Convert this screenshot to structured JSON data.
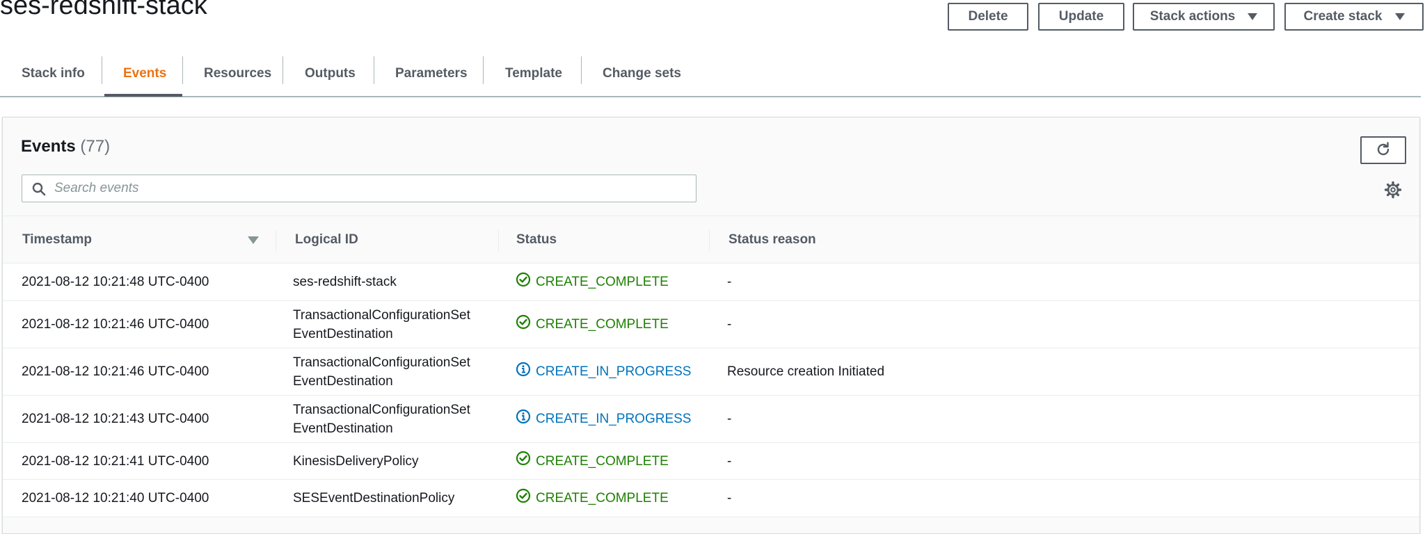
{
  "header": {
    "title": "ses-redshift-stack",
    "buttons": {
      "delete": "Delete",
      "update": "Update",
      "stack_actions": "Stack actions",
      "create_stack": "Create stack"
    }
  },
  "tabs": [
    {
      "label": "Stack info"
    },
    {
      "label": "Events"
    },
    {
      "label": "Resources"
    },
    {
      "label": "Outputs"
    },
    {
      "label": "Parameters"
    },
    {
      "label": "Template"
    },
    {
      "label": "Change sets"
    }
  ],
  "active_tab": "Events",
  "events": {
    "title": "Events",
    "count": "(77)",
    "search_placeholder": "Search events",
    "columns": [
      "Timestamp",
      "Logical ID",
      "Status",
      "Status reason"
    ],
    "rows": [
      {
        "timestamp": "2021-08-12 10:21:48 UTC-0400",
        "logical_id": "ses-redshift-stack",
        "status": "CREATE_COMPLETE",
        "reason": "-"
      },
      {
        "timestamp": "2021-08-12 10:21:46 UTC-0400",
        "logical_id": "TransactionalConfigurationSet\nEventDestination",
        "status": "CREATE_COMPLETE",
        "reason": "-"
      },
      {
        "timestamp": "2021-08-12 10:21:46 UTC-0400",
        "logical_id": "TransactionalConfigurationSet\nEventDestination",
        "status": "CREATE_IN_PROGRESS",
        "reason": "Resource creation Initiated"
      },
      {
        "timestamp": "2021-08-12 10:21:43 UTC-0400",
        "logical_id": "TransactionalConfigurationSet\nEventDestination",
        "status": "CREATE_IN_PROGRESS",
        "reason": "-"
      },
      {
        "timestamp": "2021-08-12 10:21:41 UTC-0400",
        "logical_id": "KinesisDeliveryPolicy",
        "status": "CREATE_COMPLETE",
        "reason": "-"
      },
      {
        "timestamp": "2021-08-12 10:21:40 UTC-0400",
        "logical_id": "SESEventDestinationPolicy",
        "status": "CREATE_COMPLETE",
        "reason": "-"
      }
    ]
  },
  "colors": {
    "accent": "#ec7211",
    "success": "#1d8102",
    "info": "#0073bb",
    "text": "#16191f",
    "muted": "#545b64"
  },
  "icons": {
    "search": "search-icon",
    "refresh": "refresh-icon",
    "settings": "gear-icon",
    "success": "check-circle-icon",
    "in_progress": "info-circle-icon",
    "sort": "sort-descending-icon",
    "dropdown": "caret-down-icon"
  }
}
